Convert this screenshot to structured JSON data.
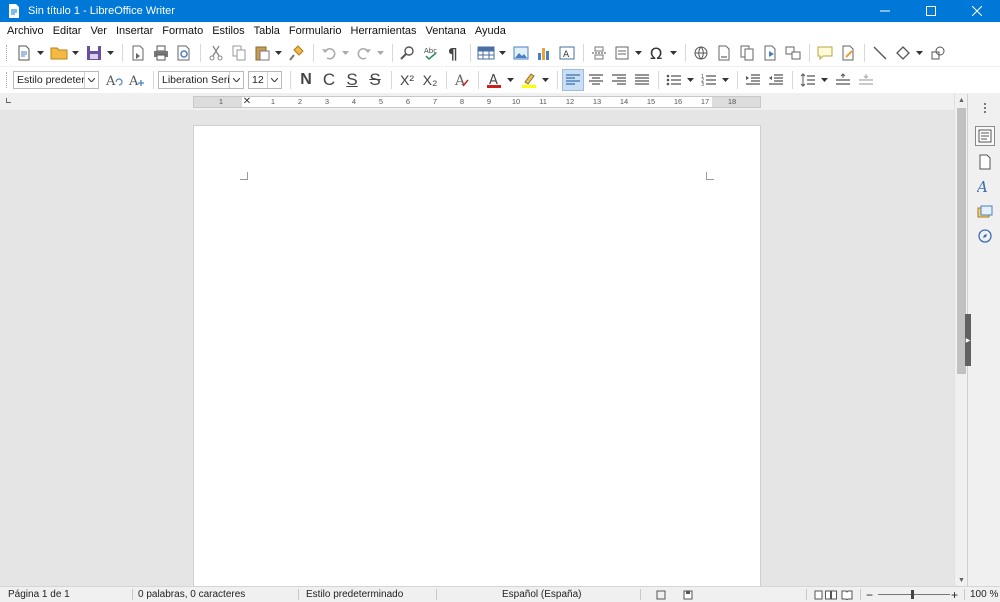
{
  "window": {
    "title": "Sin título 1 - LibreOffice Writer",
    "controls": [
      "minimize",
      "maximize",
      "close"
    ]
  },
  "menu": [
    "Archivo",
    "Editar",
    "Ver",
    "Insertar",
    "Formato",
    "Estilos",
    "Tabla",
    "Formulario",
    "Herramientas",
    "Ventana",
    "Ayuda"
  ],
  "formatting": {
    "paragraph_style": "Estilo predeterminado",
    "font_name": "Liberation Serif",
    "font_size": "12",
    "bold_label": "N",
    "italic_label": "C",
    "underline_label": "S",
    "strike_label": "S",
    "superscript_label": "X²",
    "subscript_label": "X₂"
  },
  "ruler": {
    "labels_left": [
      "1"
    ],
    "labels_right": [
      "1",
      "2",
      "3",
      "4",
      "5",
      "6",
      "7",
      "8",
      "9",
      "10",
      "11",
      "12",
      "13",
      "14",
      "15",
      "16",
      "17",
      "18"
    ]
  },
  "status": {
    "page": "Página 1 de 1",
    "words": "0 palabras, 0 caracteres",
    "style": "Estilo predeterminado",
    "language": "Español (España)",
    "zoom": "100 %",
    "zoom_minus": "−",
    "zoom_plus": "+"
  },
  "colors": {
    "titlebar": "#0078d7",
    "font_color": "#c9211e",
    "highlight_color": "#ffff00",
    "workspace": "#e5e5e5"
  }
}
